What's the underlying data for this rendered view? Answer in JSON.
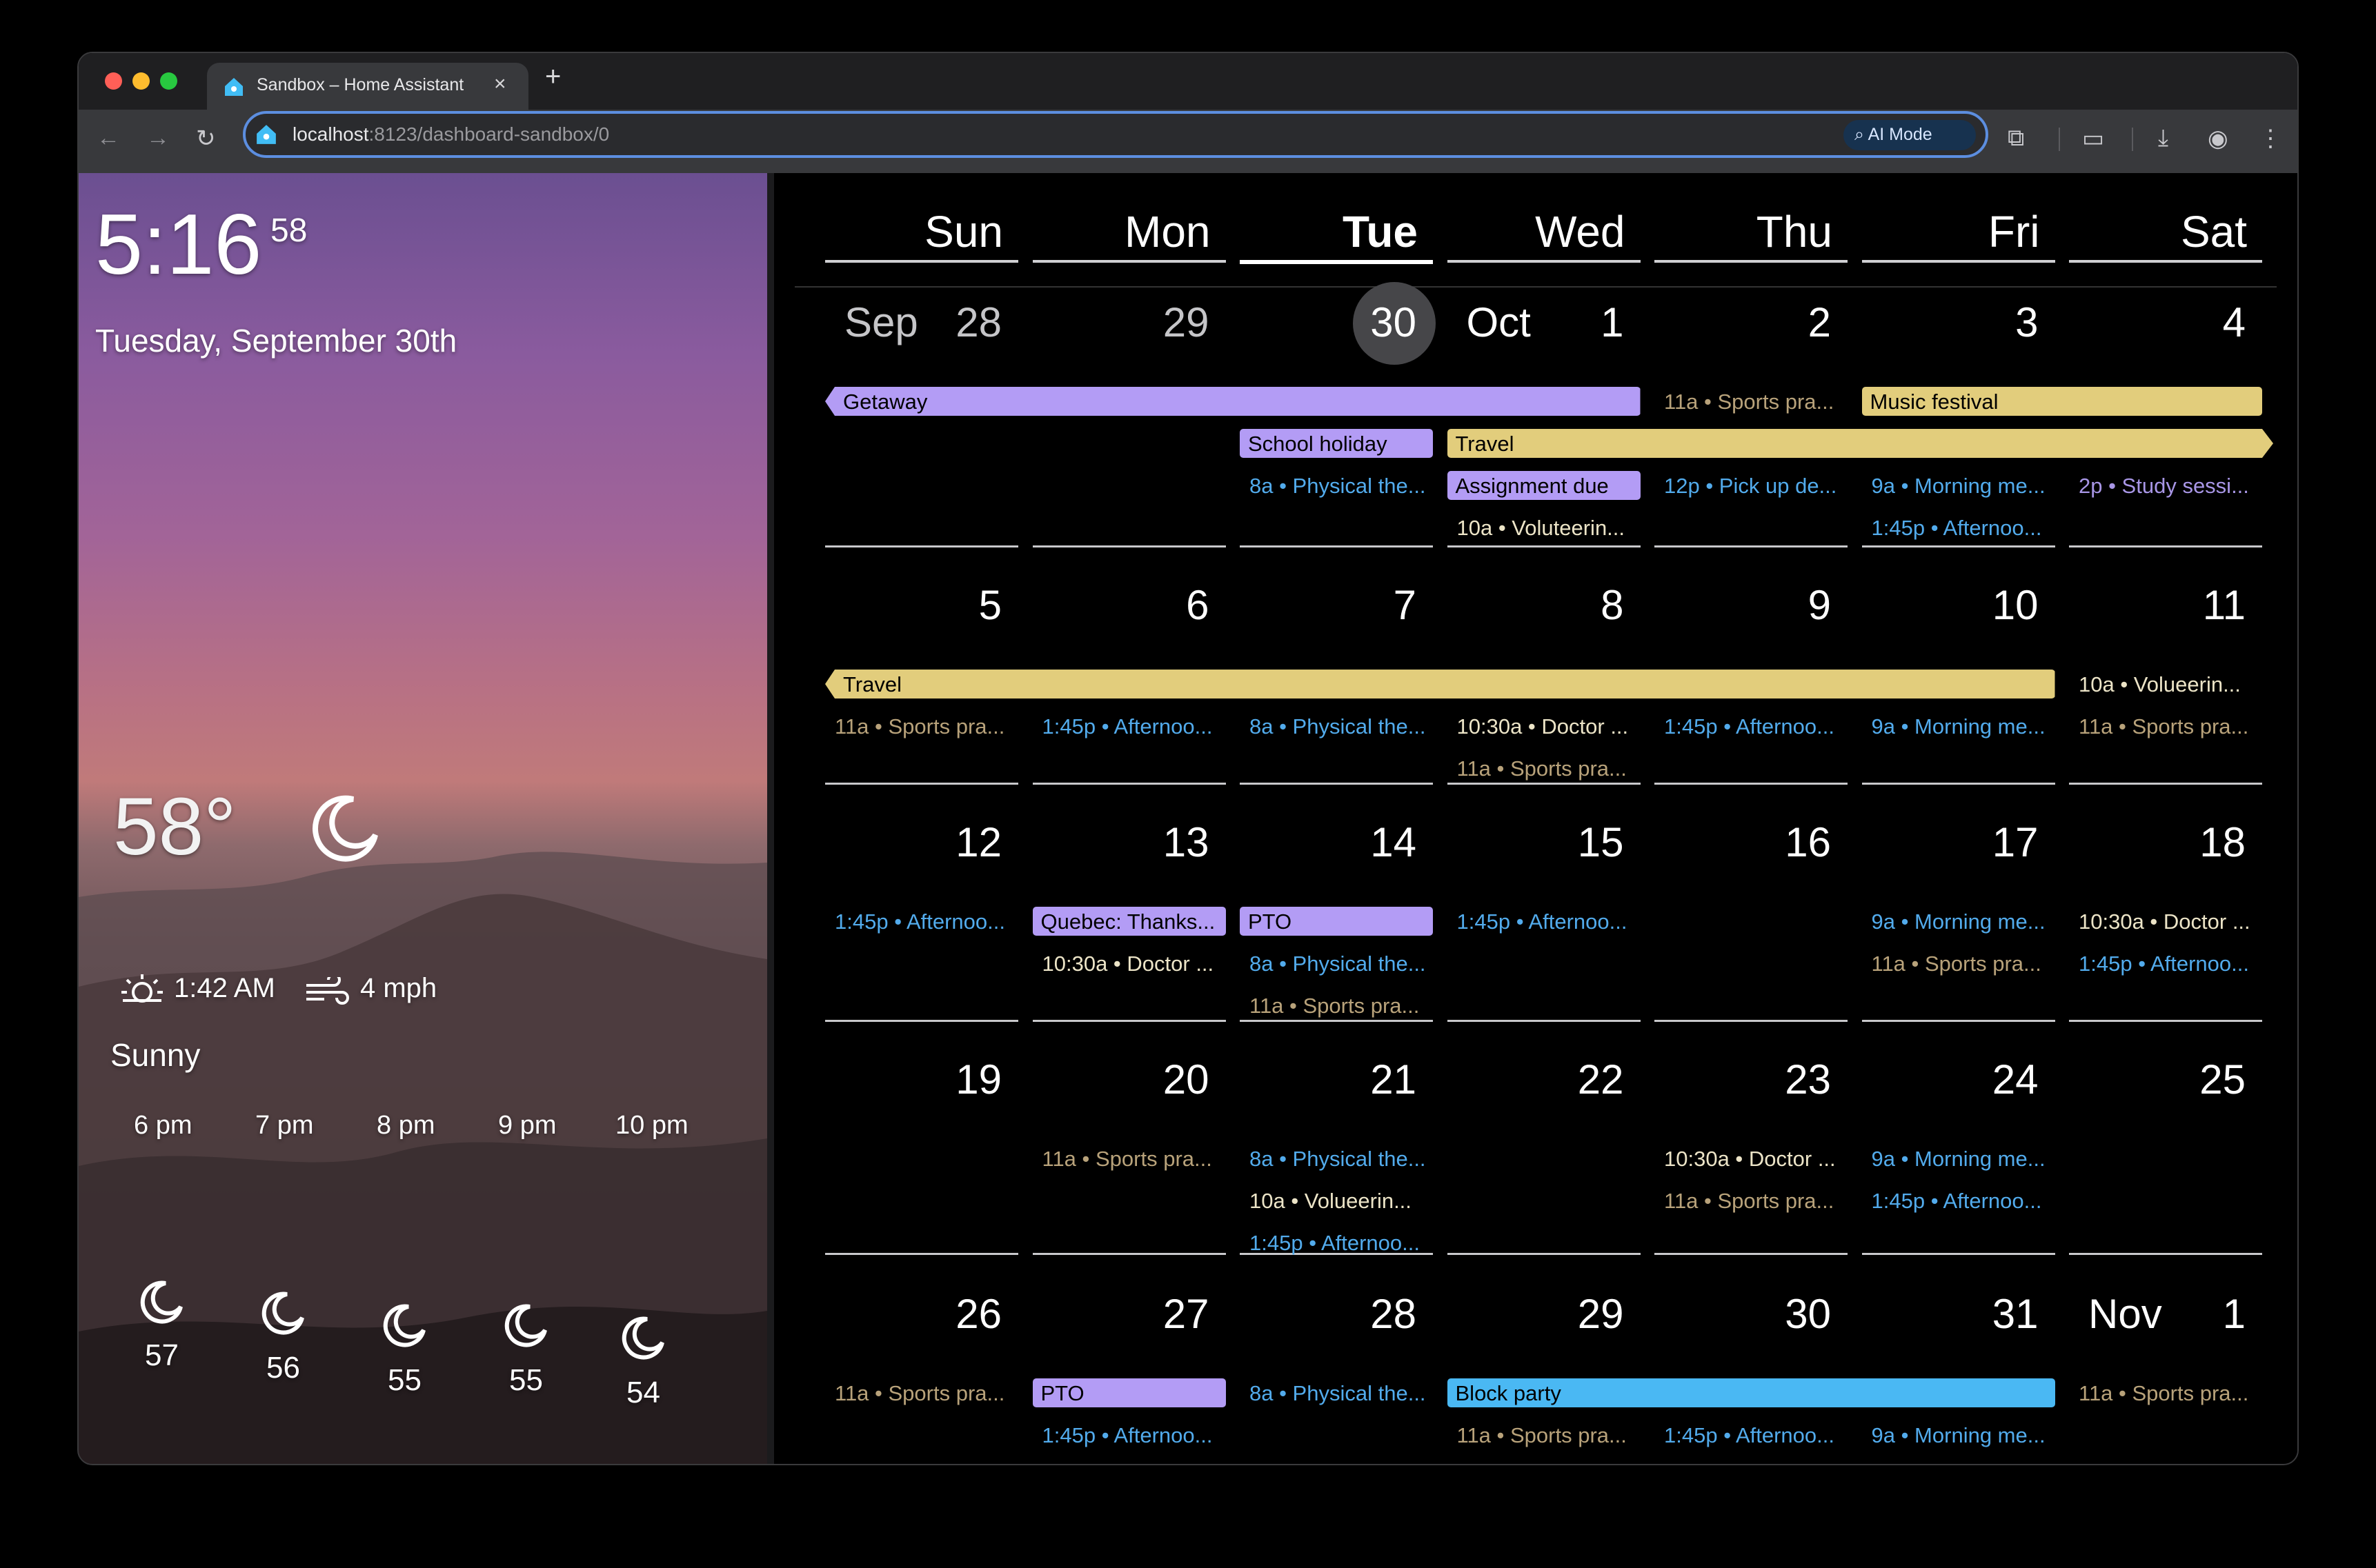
{
  "browser": {
    "tab_title": "Sandbox – Home Assistant",
    "tab_close": "×",
    "new_tab": "+",
    "url_host": "localhost",
    "url_rest": ":8123/dashboard-sandbox/0",
    "ai_mode": "AI Mode",
    "icons": [
      "back-icon",
      "forward-icon",
      "reload-icon",
      "extensions-icon",
      "reading-mode-icon",
      "download-icon",
      "profile-icon",
      "menu-icon"
    ]
  },
  "weather": {
    "time": "5:16",
    "seconds": "58",
    "date": "Tuesday, September 30th",
    "temperature": "58°",
    "sun_time": "1:42 AM",
    "wind": "4 mph",
    "condition": "Sunny",
    "forecast": [
      {
        "time": "6 pm",
        "temp": "57",
        "icon": "moon-icon"
      },
      {
        "time": "7 pm",
        "temp": "56",
        "icon": "moon-icon"
      },
      {
        "time": "8 pm",
        "temp": "55",
        "icon": "moon-icon"
      },
      {
        "time": "9 pm",
        "temp": "55",
        "icon": "moon-icon"
      },
      {
        "time": "10 pm",
        "temp": "54",
        "icon": "moon-icon"
      }
    ]
  },
  "calendar": {
    "days_of_week": [
      "Sun",
      "Mon",
      "Tue",
      "Wed",
      "Thu",
      "Fri",
      "Sat"
    ],
    "today_index": 2,
    "weeks": [
      {
        "days": [
          {
            "month": "Sep",
            "num": "28",
            "muted": true
          },
          {
            "month": "",
            "num": "29",
            "muted": true
          },
          {
            "month": "",
            "num": "30",
            "today": true
          },
          {
            "month": "Oct",
            "num": "1"
          },
          {
            "month": "",
            "num": "2"
          },
          {
            "month": "",
            "num": "3"
          },
          {
            "month": "",
            "num": "4"
          }
        ],
        "bars": [
          {
            "label": "Getaway",
            "color": "purple"
          },
          {
            "label": "Music festival",
            "color": "yellow"
          },
          {
            "label": "School holiday",
            "color": "purple"
          },
          {
            "label": "Travel",
            "color": "yellow"
          },
          {
            "label": "Assignment due",
            "color": "purple"
          }
        ],
        "events": [
          {
            "text": "11a • Sports pra...",
            "color": "tan"
          },
          {
            "text": "8a • Physical the...",
            "color": "blue"
          },
          {
            "text": "12p • Pick up de...",
            "color": "blue"
          },
          {
            "text": "9a • Morning me...",
            "color": "blue"
          },
          {
            "text": "2p • Study sessi...",
            "color": "purple"
          },
          {
            "text": "10a • Voluteerin...",
            "color": "cream"
          },
          {
            "text": "1:45p • Afternoo...",
            "color": "blue"
          }
        ]
      },
      {
        "days": [
          {
            "month": "",
            "num": "5"
          },
          {
            "month": "",
            "num": "6"
          },
          {
            "month": "",
            "num": "7"
          },
          {
            "month": "",
            "num": "8"
          },
          {
            "month": "",
            "num": "9"
          },
          {
            "month": "",
            "num": "10"
          },
          {
            "month": "",
            "num": "11"
          }
        ],
        "bars": [
          {
            "label": "Travel",
            "color": "yellow"
          }
        ],
        "events": [
          {
            "text": "10a • Volueerin...",
            "color": "cream"
          },
          {
            "text": "11a • Sports pra...",
            "color": "tan"
          },
          {
            "text": "1:45p • Afternoo...",
            "color": "blue"
          },
          {
            "text": "8a • Physical the...",
            "color": "blue"
          },
          {
            "text": "10:30a • Doctor ...",
            "color": "cream"
          },
          {
            "text": "1:45p • Afternoo...",
            "color": "blue"
          },
          {
            "text": "9a • Morning me...",
            "color": "blue"
          },
          {
            "text": "11a • Sports pra...",
            "color": "tan"
          },
          {
            "text": "11a • Sports pra...",
            "color": "tan"
          }
        ]
      },
      {
        "days": [
          {
            "month": "",
            "num": "12"
          },
          {
            "month": "",
            "num": "13"
          },
          {
            "month": "",
            "num": "14"
          },
          {
            "month": "",
            "num": "15"
          },
          {
            "month": "",
            "num": "16"
          },
          {
            "month": "",
            "num": "17"
          },
          {
            "month": "",
            "num": "18"
          }
        ],
        "bars": [
          {
            "label": "Quebec: Thanks...",
            "color": "purple"
          },
          {
            "label": "PTO",
            "color": "purple"
          }
        ],
        "events": [
          {
            "text": "1:45p • Afternoo...",
            "color": "blue"
          },
          {
            "text": "1:45p • Afternoo...",
            "color": "blue"
          },
          {
            "text": "9a • Morning me...",
            "color": "blue"
          },
          {
            "text": "10:30a • Doctor ...",
            "color": "cream"
          },
          {
            "text": "10:30a • Doctor ...",
            "color": "cream"
          },
          {
            "text": "8a • Physical the...",
            "color": "blue"
          },
          {
            "text": "11a • Sports pra...",
            "color": "tan"
          },
          {
            "text": "1:45p • Afternoo...",
            "color": "blue"
          },
          {
            "text": "11a • Sports pra...",
            "color": "tan"
          }
        ]
      },
      {
        "days": [
          {
            "month": "",
            "num": "19"
          },
          {
            "month": "",
            "num": "20"
          },
          {
            "month": "",
            "num": "21"
          },
          {
            "month": "",
            "num": "22"
          },
          {
            "month": "",
            "num": "23"
          },
          {
            "month": "",
            "num": "24"
          },
          {
            "month": "",
            "num": "25"
          }
        ],
        "bars": [],
        "events": [
          {
            "text": "11a • Sports pra...",
            "color": "tan"
          },
          {
            "text": "8a • Physical the...",
            "color": "blue"
          },
          {
            "text": "10:30a • Doctor ...",
            "color": "cream"
          },
          {
            "text": "9a • Morning me...",
            "color": "blue"
          },
          {
            "text": "10a • Volueerin...",
            "color": "cream"
          },
          {
            "text": "11a • Sports pra...",
            "color": "tan"
          },
          {
            "text": "1:45p • Afternoo...",
            "color": "blue"
          },
          {
            "text": "1:45p • Afternoo...",
            "color": "blue"
          }
        ]
      },
      {
        "days": [
          {
            "month": "",
            "num": "26"
          },
          {
            "month": "",
            "num": "27"
          },
          {
            "month": "",
            "num": "28"
          },
          {
            "month": "",
            "num": "29"
          },
          {
            "month": "",
            "num": "30"
          },
          {
            "month": "",
            "num": "31"
          },
          {
            "month": "Nov",
            "num": "1"
          }
        ],
        "bars": [
          {
            "label": "PTO",
            "color": "purple"
          },
          {
            "label": "Block party",
            "color": "blue"
          }
        ],
        "events": [
          {
            "text": "11a • Sports pra...",
            "color": "tan"
          },
          {
            "text": "8a • Physical the...",
            "color": "blue"
          },
          {
            "text": "11a • Sports pra...",
            "color": "tan"
          },
          {
            "text": "1:45p • Afternoo...",
            "color": "blue"
          },
          {
            "text": "11a • Sports pra...",
            "color": "tan"
          },
          {
            "text": "1:45p • Afternoo...",
            "color": "blue"
          },
          {
            "text": "9a • Morning me...",
            "color": "blue"
          }
        ]
      }
    ]
  }
}
